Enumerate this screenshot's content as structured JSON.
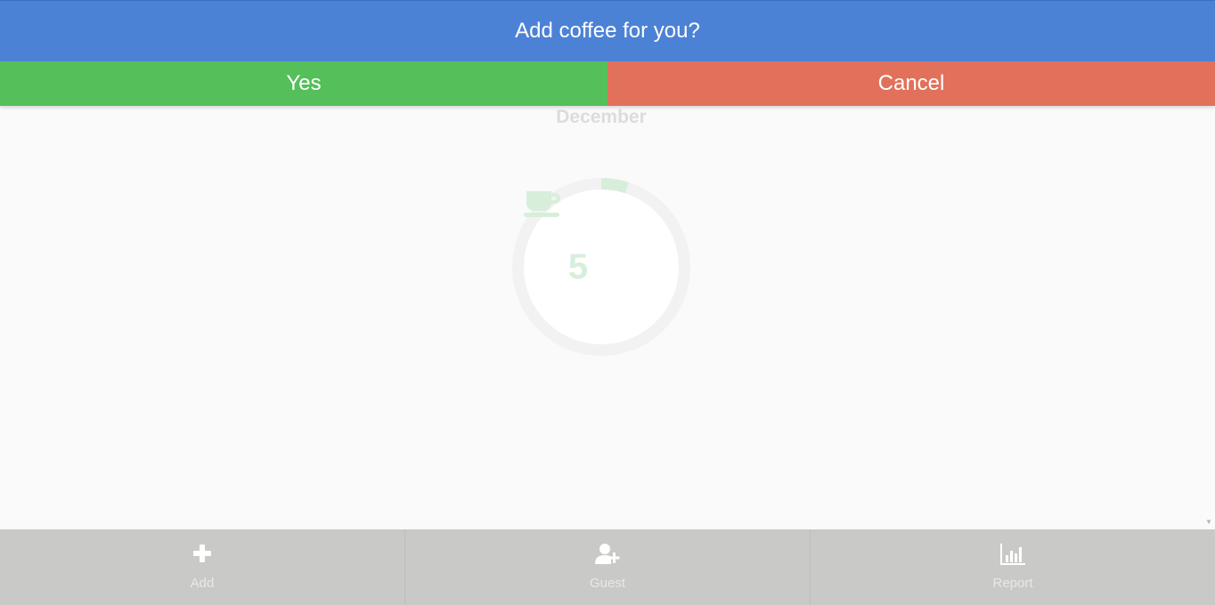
{
  "dialog": {
    "title": "Add coffee for you?",
    "yes_label": "Yes",
    "cancel_label": "Cancel"
  },
  "main": {
    "month": "December",
    "count": "5",
    "count_icon": "coffee-cup-icon",
    "progress_fraction": 0.05
  },
  "bottom_nav": {
    "items": [
      {
        "label": "Add",
        "icon": "plus-icon"
      },
      {
        "label": "Guest",
        "icon": "add-user-icon"
      },
      {
        "label": "Report",
        "icon": "bar-chart-icon"
      }
    ]
  },
  "colors": {
    "header_blue": "#4c82d6",
    "yes_green": "#55bf59",
    "cancel_red": "#e2715b",
    "nav_gray": "#c9c9c7"
  }
}
